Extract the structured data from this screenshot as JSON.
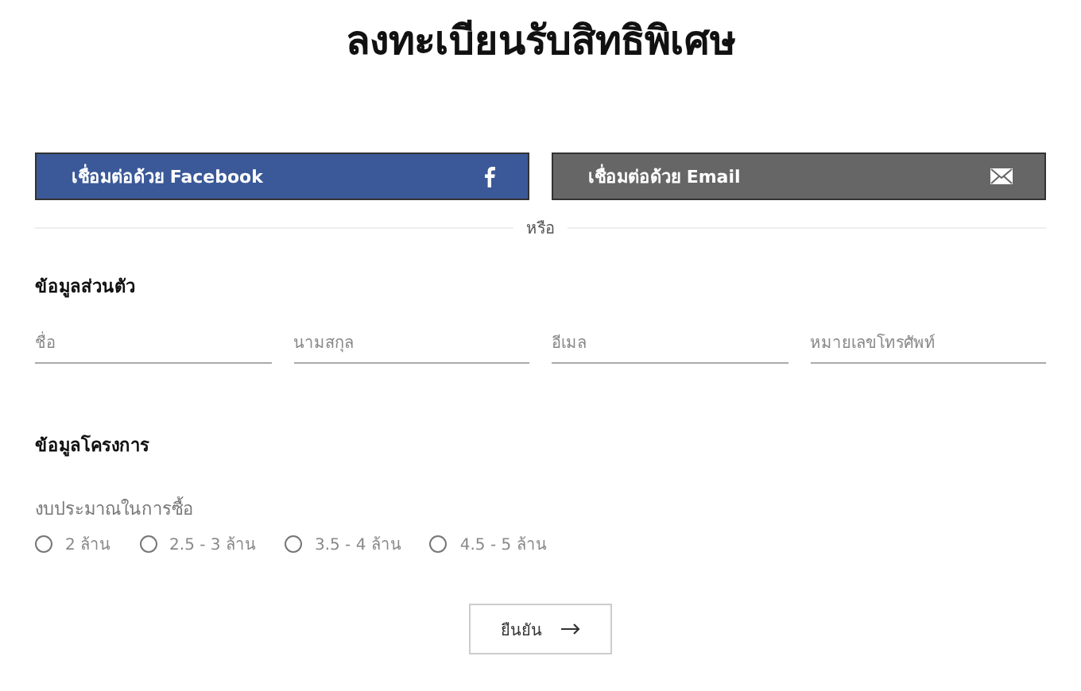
{
  "title": "ลงทะเบียนรับสิทธิพิเศษ",
  "social_buttons": [
    {
      "kind": "facebook",
      "label": "เชื่อมต่อด้วย Facebook"
    },
    {
      "kind": "email",
      "label": "เชื่อมต่อด้วย Email"
    }
  ],
  "divider": "หรือ",
  "personal": {
    "heading": "ข้อมูลส่วนตัว",
    "fields": [
      {
        "placeholder": "ชื่อ"
      },
      {
        "placeholder": "นามสกุล"
      },
      {
        "placeholder": "อีเมล"
      },
      {
        "placeholder": "หมายเลขโทรศัพท์"
      }
    ]
  },
  "project": {
    "heading": "ข้อมูลโครงการ",
    "budget_label": "งบประมาณในการซื้อ",
    "options": [
      {
        "label": "2 ล้าน",
        "selected": false
      },
      {
        "label": "2.5 - 3 ล้าน",
        "selected": false
      },
      {
        "label": "3.5 - 4 ล้าน",
        "selected": false
      },
      {
        "label": "4.5 - 5 ล้าน",
        "selected": false
      }
    ]
  },
  "submit": {
    "label": "ยืนยัน"
  }
}
